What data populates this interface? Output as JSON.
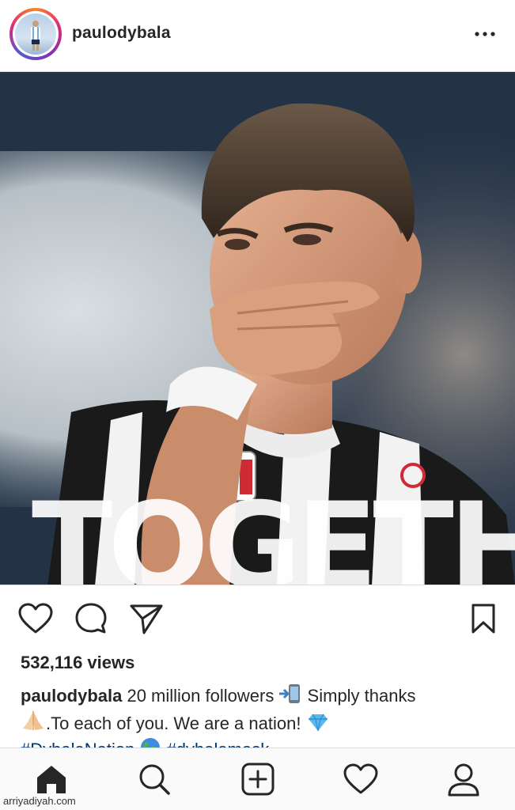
{
  "post": {
    "username": "paulodybala",
    "overlay_text": "TOGETH",
    "views_count": "532,116 views",
    "caption": {
      "username": "paulodybala",
      "text_part1": " 20 million followers ",
      "text_part2": " Simply thanks",
      "text_part3": ".To each of you. We are a nation! ",
      "hashtag1": "#DybalaNation",
      "hashtag2": "#dybalamask"
    }
  },
  "icons": {
    "like": "heart-outline-icon",
    "comment": "comment-bubble-icon",
    "share": "paper-plane-icon",
    "save": "bookmark-icon",
    "more": "three-dots-icon"
  },
  "nav": [
    "home-icon",
    "search-icon",
    "new-post-icon",
    "activity-heart-icon",
    "profile-icon"
  ],
  "watermark": "arriyadiyah.com",
  "colors": {
    "text": "#262626",
    "hashtag": "#003569",
    "divider": "#dbdbdb",
    "nav_background": "#fafafa"
  }
}
